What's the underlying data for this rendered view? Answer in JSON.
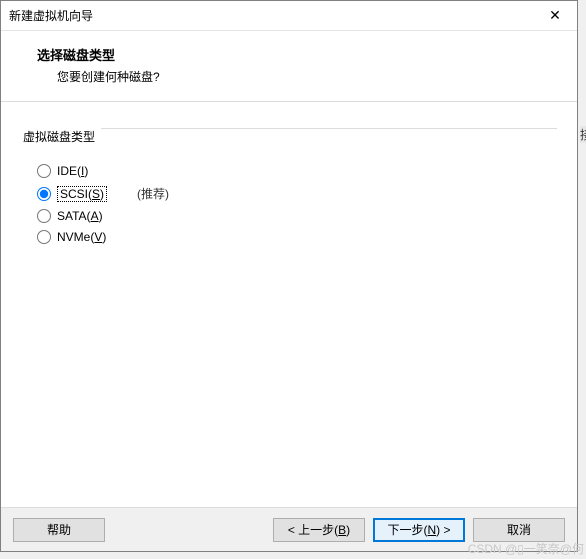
{
  "window": {
    "title": "新建虚拟机向导",
    "close_glyph": "✕"
  },
  "header": {
    "title": "选择磁盘类型",
    "subtitle": "您要创建何种磁盘?"
  },
  "group": {
    "title": "虚拟磁盘类型",
    "recommend": "(推荐)",
    "options": [
      {
        "prefix": "IDE(",
        "hotkey": "I",
        "suffix": ")",
        "selected": false
      },
      {
        "prefix": "SCSI(",
        "hotkey": "S",
        "suffix": ")",
        "selected": true
      },
      {
        "prefix": "SATA(",
        "hotkey": "A",
        "suffix": ")",
        "selected": false
      },
      {
        "prefix": "NVMe(",
        "hotkey": "V",
        "suffix": ")",
        "selected": false
      }
    ]
  },
  "footer": {
    "help": "帮助",
    "back_prefix": "< 上一步(",
    "back_hotkey": "B",
    "back_suffix": ")",
    "next_prefix": "下一步(",
    "next_hotkey": "N",
    "next_suffix": ") >",
    "cancel": "取消"
  },
  "watermark": "CSDN @▯一笑奈@何",
  "edge_glyph": "接"
}
